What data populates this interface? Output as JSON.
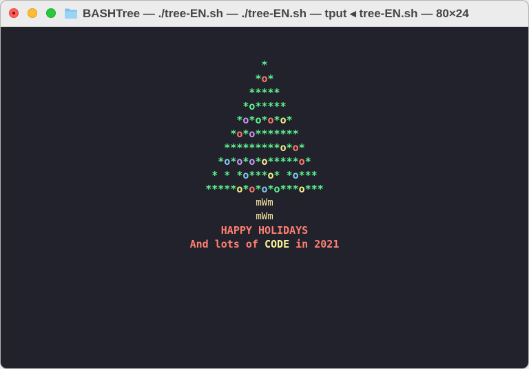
{
  "window": {
    "title": "BASHTree — ./tree-EN.sh — ./tree-EN.sh — tput ◂ tree-EN.sh — 80×24",
    "title_icon": "folder-icon"
  },
  "colors": {
    "background": "#22222c",
    "green": "#5ef58c",
    "red": "#ff7a6e",
    "purple": "#c79bf2",
    "blue": "#84c8f5",
    "yellow": "#f4f28a",
    "trunk": "#f5e6a0",
    "message": "#ff8070",
    "code_highlight": "#f7f39a"
  },
  "tree": [
    [
      {
        "t": "*",
        "c": "green"
      }
    ],
    [
      {
        "t": "*",
        "c": "green"
      },
      {
        "t": "o",
        "c": "red"
      },
      {
        "t": "*",
        "c": "green"
      }
    ],
    [
      {
        "t": "*****",
        "c": "green"
      }
    ],
    [
      {
        "t": "*",
        "c": "green"
      },
      {
        "t": "o",
        "c": "green"
      },
      {
        "t": "*****",
        "c": "green"
      }
    ],
    [
      {
        "t": "*",
        "c": "green"
      },
      {
        "t": "o",
        "c": "purple"
      },
      {
        "t": "*",
        "c": "green"
      },
      {
        "t": "o",
        "c": "green"
      },
      {
        "t": "*",
        "c": "green"
      },
      {
        "t": "o",
        "c": "red"
      },
      {
        "t": "*",
        "c": "green"
      },
      {
        "t": "o",
        "c": "yellow"
      },
      {
        "t": "*",
        "c": "green"
      }
    ],
    [
      {
        "t": "*",
        "c": "green"
      },
      {
        "t": "o",
        "c": "red"
      },
      {
        "t": "*",
        "c": "green"
      },
      {
        "t": "o",
        "c": "purple"
      },
      {
        "t": "*******",
        "c": "green"
      }
    ],
    [
      {
        "t": "*********",
        "c": "green"
      },
      {
        "t": "o",
        "c": "yellow"
      },
      {
        "t": "*",
        "c": "green"
      },
      {
        "t": "o",
        "c": "red"
      },
      {
        "t": "*",
        "c": "green"
      }
    ],
    [
      {
        "t": "*",
        "c": "green"
      },
      {
        "t": "o",
        "c": "blue"
      },
      {
        "t": "*",
        "c": "green"
      },
      {
        "t": "o",
        "c": "purple"
      },
      {
        "t": "*",
        "c": "green"
      },
      {
        "t": "o",
        "c": "purple"
      },
      {
        "t": "*",
        "c": "green"
      },
      {
        "t": "o",
        "c": "yellow"
      },
      {
        "t": "*****",
        "c": "green"
      },
      {
        "t": "o",
        "c": "red"
      },
      {
        "t": "*",
        "c": "green"
      }
    ],
    [
      {
        "t": "* * *",
        "c": "green"
      },
      {
        "t": "o",
        "c": "blue"
      },
      {
        "t": "***",
        "c": "green"
      },
      {
        "t": "o",
        "c": "yellow"
      },
      {
        "t": "* *",
        "c": "green"
      },
      {
        "t": "o",
        "c": "blue"
      },
      {
        "t": "***",
        "c": "green"
      }
    ],
    [
      {
        "t": "*****",
        "c": "green"
      },
      {
        "t": "o",
        "c": "yellow"
      },
      {
        "t": "*",
        "c": "green"
      },
      {
        "t": "o",
        "c": "red"
      },
      {
        "t": "*",
        "c": "green"
      },
      {
        "t": "o",
        "c": "blue"
      },
      {
        "t": "*",
        "c": "green"
      },
      {
        "t": "o",
        "c": "green"
      },
      {
        "t": "***",
        "c": "green"
      },
      {
        "t": "o",
        "c": "yellow"
      },
      {
        "t": "***",
        "c": "green"
      }
    ]
  ],
  "trunk": [
    "mWm",
    "mWm"
  ],
  "message": {
    "greeting": "HAPPY HOLIDAYS",
    "line2_prefix": "And lots of ",
    "line2_highlight": "CODE",
    "line2_suffix": " in 2021"
  }
}
